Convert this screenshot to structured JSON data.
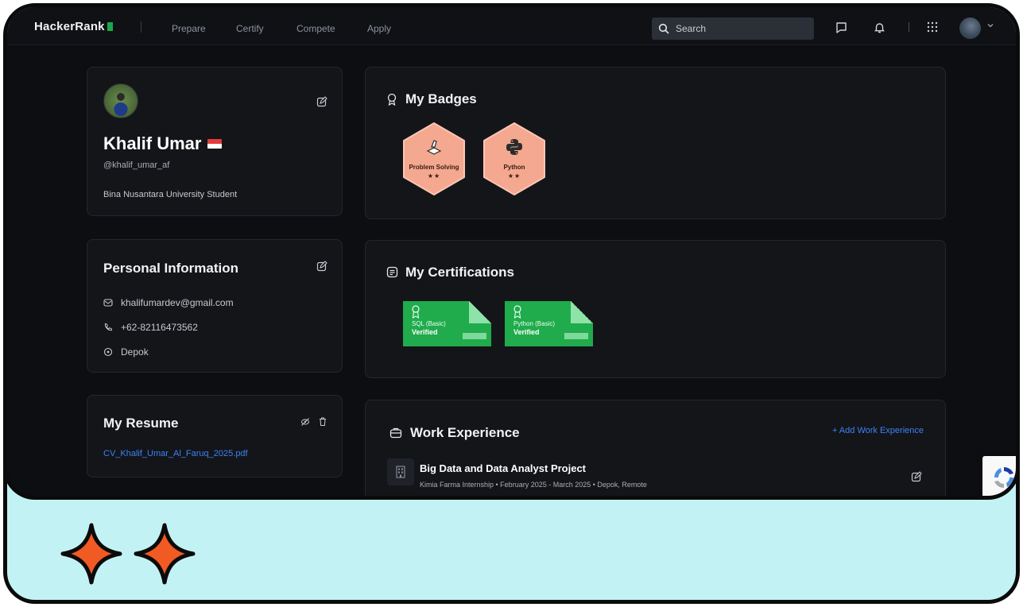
{
  "navbar": {
    "logo": "HackerRank",
    "links": [
      "Prepare",
      "Certify",
      "Compete",
      "Apply"
    ],
    "search_placeholder": "Search"
  },
  "profile": {
    "name": "Khalif Umar",
    "handle": "@khalif_umar_af",
    "bio": "Bina Nusantara University Student"
  },
  "personal_info": {
    "title": "Personal Information",
    "email": "khalifumardev@gmail.com",
    "phone": "+62-82116473562",
    "location": "Depok"
  },
  "resume": {
    "title": "My Resume",
    "file": "CV_Khalif_Umar_Al_Faruq_2025.pdf"
  },
  "badges": {
    "title": "My Badges",
    "items": [
      {
        "label": "Problem Solving",
        "stars": "★★"
      },
      {
        "label": "Python",
        "stars": "★★"
      }
    ]
  },
  "certifications": {
    "title": "My Certifications",
    "items": [
      {
        "name": "SQL (Basic)",
        "status": "Verified"
      },
      {
        "name": "Python (Basic)",
        "status": "Verified"
      }
    ]
  },
  "work": {
    "title": "Work Experience",
    "add_label": "+ Add Work Experience",
    "items": [
      {
        "title": "Big Data and Data Analyst Project",
        "meta": "Kimia Farma Internship  •  February 2025 - March 2025  •  Depok, Remote"
      }
    ]
  },
  "colors": {
    "accent_green": "#1ba94c",
    "link_blue": "#3b82f6",
    "badge_fill": "#f4a88f",
    "frame_cyan": "#c3f2f4",
    "sparkle_orange": "#f15a22"
  }
}
